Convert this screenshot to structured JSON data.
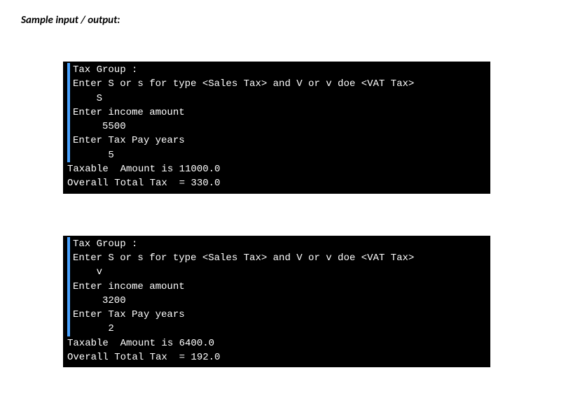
{
  "heading": "Sample input / output:",
  "console1": {
    "line1": "Tax Group :",
    "line2": "Enter S or s for type <Sales Tax> and V or v doe <VAT Tax>",
    "line3": "    S",
    "line4": "Enter income amount",
    "line5": "     5500",
    "line6": "Enter Tax Pay years",
    "line7": "      5",
    "line8": "Taxable  Amount is 11000.0",
    "line9": "Overall Total Tax  = 330.0"
  },
  "console2": {
    "line1": "Tax Group :",
    "line2": "Enter S or s for type <Sales Tax> and V or v doe <VAT Tax>",
    "line3": "    v",
    "line4": "Enter income amount",
    "line5": "     3200",
    "line6": "Enter Tax Pay years",
    "line7": "      2",
    "line8": "Taxable  Amount is 6400.0",
    "line9": "Overall Total Tax  = 192.0"
  }
}
